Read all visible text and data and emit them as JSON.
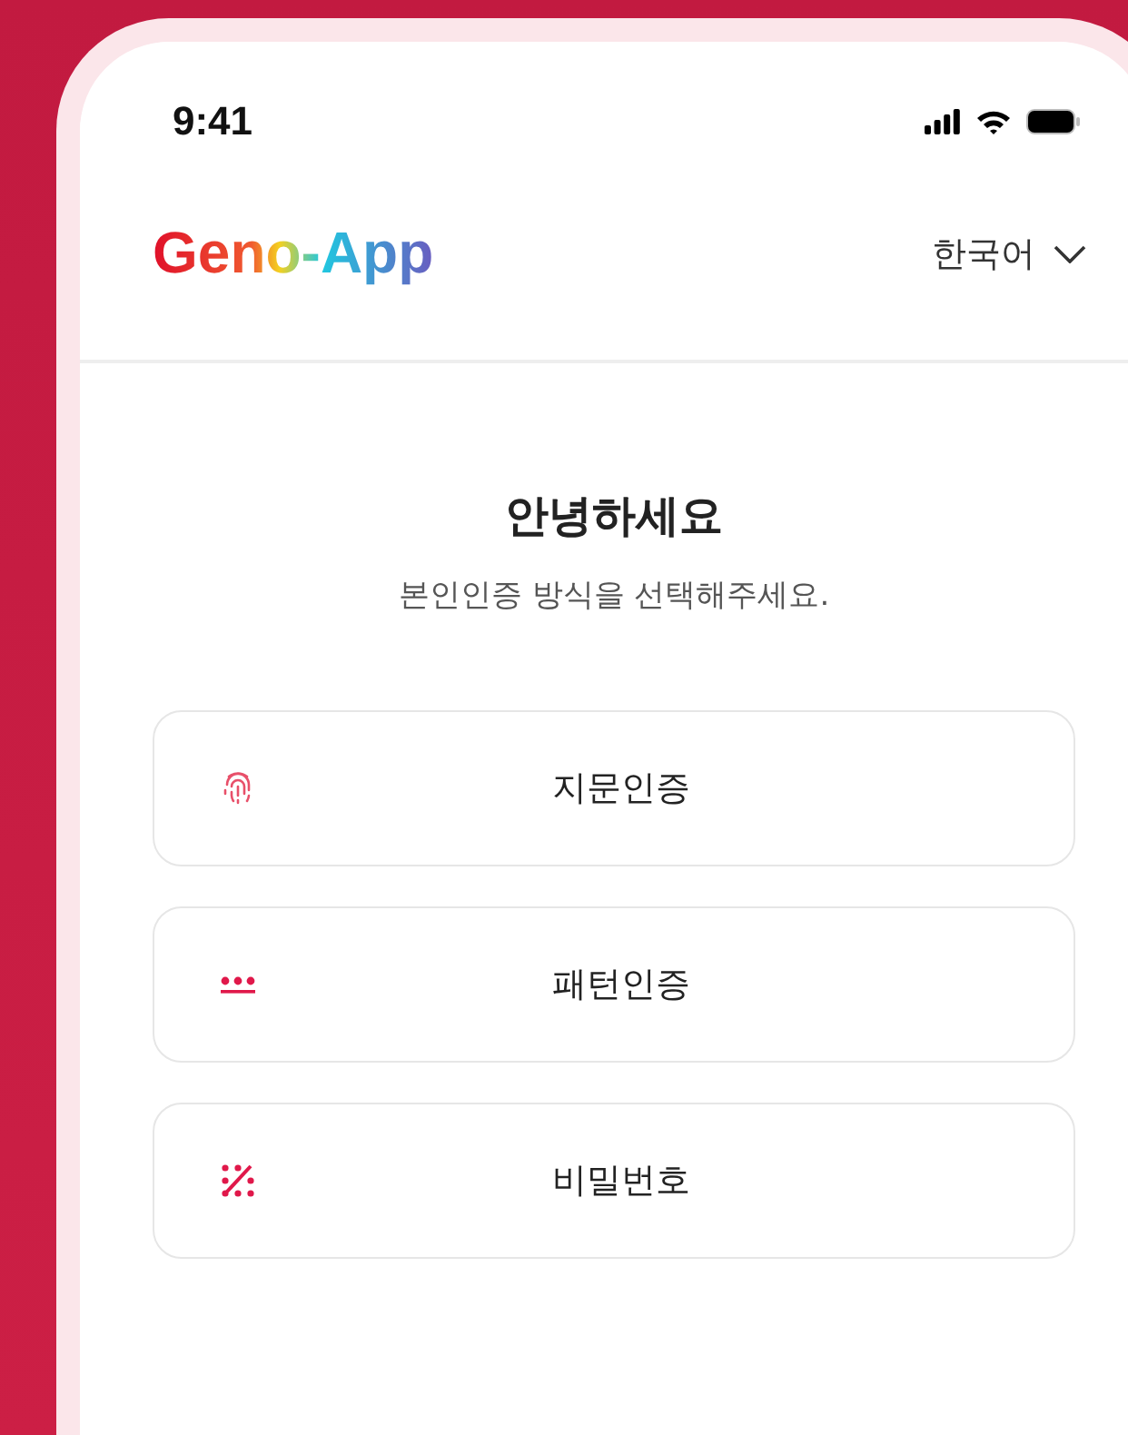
{
  "status_bar": {
    "time": "9:41"
  },
  "header": {
    "logo": "Geno-App",
    "language": "한국어"
  },
  "greeting": {
    "title": "안녕하세요",
    "subtitle": "본인인증 방식을 선택해주세요."
  },
  "methods": [
    {
      "kind": "fingerprint",
      "label": "지문인증"
    },
    {
      "kind": "pattern",
      "label": "패턴인증"
    },
    {
      "kind": "password",
      "label": "비밀번호"
    }
  ]
}
